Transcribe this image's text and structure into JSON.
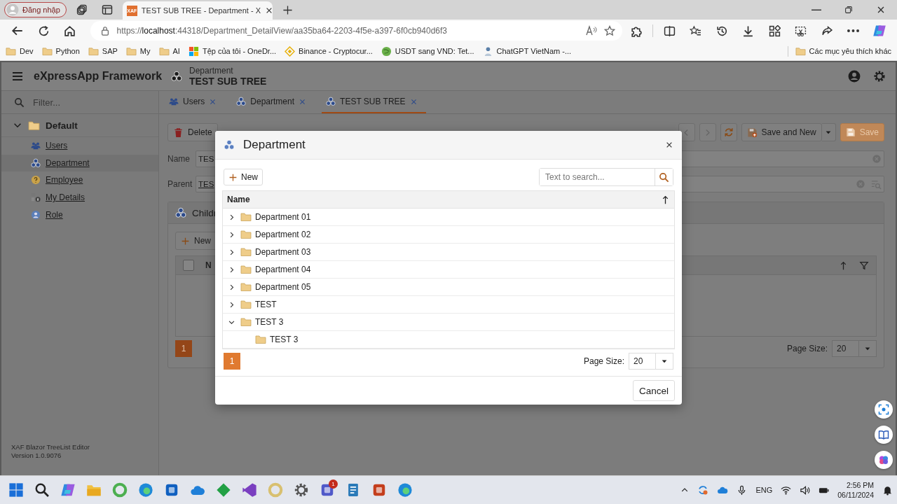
{
  "browser": {
    "profile_button": "Đăng nhập",
    "tabs": [
      {
        "favicon_text": "XAF",
        "title": "TEST SUB TREE - Department - X",
        "selected": true
      }
    ],
    "url": "https://**localhost**:44318/Department_DetailView/aa35ba64-2203-4f5e-a397-6f0cb940d6f3",
    "bookmarks": [
      {
        "kind": "folder",
        "label": "Dev"
      },
      {
        "kind": "folder",
        "label": "Python"
      },
      {
        "kind": "folder",
        "label": "SAP"
      },
      {
        "kind": "folder",
        "label": "My"
      },
      {
        "kind": "folder",
        "label": "AI"
      },
      {
        "kind": "grid",
        "label": "Tệp của tôi - OneDr..."
      },
      {
        "kind": "diamond",
        "label": "Binance - Cryptocur..."
      },
      {
        "kind": "circle",
        "label": "USDT sang VND: Tet..."
      },
      {
        "kind": "figure",
        "label": "ChatGPT VietNam -..."
      }
    ],
    "other_bookmarks": "Các mục yêu thích khác"
  },
  "app": {
    "brand": "eXpressApp Framework",
    "view_caption": "Department",
    "view_title": "TEST SUB TREE"
  },
  "sidebar": {
    "filter_placeholder": "Filter...",
    "groups": [
      {
        "label": "Default",
        "expanded": true,
        "children": [
          {
            "label": "Users",
            "kind": "users",
            "selected": false
          },
          {
            "label": "Department",
            "kind": "department",
            "selected": true
          },
          {
            "label": "Employee",
            "kind": "employee",
            "selected": false
          },
          {
            "label": "My Details",
            "kind": "details",
            "selected": false
          },
          {
            "label": "Role",
            "kind": "role",
            "selected": false
          }
        ]
      }
    ],
    "footer": [
      "XAF Blazor TreeList Editor",
      "Version 1.0.9076"
    ]
  },
  "tabs": [
    {
      "label": "Users",
      "kind": "users",
      "selected": false
    },
    {
      "label": "Department",
      "kind": "department",
      "selected": false
    },
    {
      "label": "TEST SUB TREE",
      "kind": "department",
      "selected": true
    }
  ],
  "detail": {
    "toolbar": {
      "delete": "Delete",
      "save_and_new": "Save and New",
      "save": "Save"
    },
    "fields": [
      {
        "label": "Name",
        "value": "TES",
        "kind": "text"
      },
      {
        "label": "Parent",
        "value": "TES",
        "kind": "link"
      }
    ],
    "children_panel": {
      "title": "Childr",
      "new_button": "New",
      "select_all_checked": false,
      "column": "N",
      "pager": [
        {
          "label": "1",
          "selected": true
        }
      ],
      "page_size_label": "Page Size:",
      "page_size": "20"
    }
  },
  "dialog": {
    "title": "Department",
    "new_button": "New",
    "search_placeholder": "Text to search...",
    "column": "Name",
    "rows": [
      {
        "label": "Department 01",
        "expanded": false
      },
      {
        "label": "Department 02",
        "expanded": false
      },
      {
        "label": "Department 03",
        "expanded": false
      },
      {
        "label": "Department 04",
        "expanded": false
      },
      {
        "label": "Department 05",
        "expanded": false
      },
      {
        "label": "TEST",
        "expanded": false
      },
      {
        "label": "TEST 3",
        "expanded": true,
        "children": [
          {
            "label": "TEST 3"
          }
        ]
      }
    ],
    "pager": [
      {
        "label": "1",
        "selected": true
      }
    ],
    "page_size_label": "Page Size:",
    "page_size": "20",
    "cancel": "Cancel"
  },
  "taskbar": {
    "badge": "1",
    "language": "ENG",
    "time": "2:56 PM",
    "date": "06/11/2024"
  }
}
